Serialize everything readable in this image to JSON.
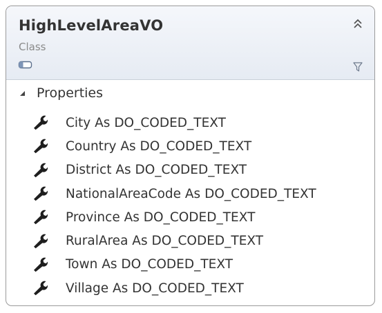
{
  "class": {
    "name": "HighLevelAreaVO",
    "kind": "Class"
  },
  "sections": [
    {
      "label": "Properties",
      "expanded": true,
      "items": [
        "City As DO_CODED_TEXT",
        "Country As DO_CODED_TEXT",
        "District As DO_CODED_TEXT",
        "NationalAreaCode As DO_CODED_TEXT",
        "Province As DO_CODED_TEXT",
        "RuralArea As DO_CODED_TEXT",
        "Town As DO_CODED_TEXT",
        "Village As DO_CODED_TEXT"
      ]
    }
  ],
  "icons": {
    "member": "wrench-icon",
    "collapse": "double-chevron-up-icon",
    "filter": "filter-icon",
    "class": "class-shape-icon",
    "section_toggle": "triangle-expanded-icon"
  },
  "colors": {
    "header_top": "#f5f7fb",
    "header_bottom": "#e6ebf3",
    "border": "#9a9a9a",
    "text": "#333333",
    "muted": "#8a8a8a",
    "wrench": "#1e1e1e"
  }
}
